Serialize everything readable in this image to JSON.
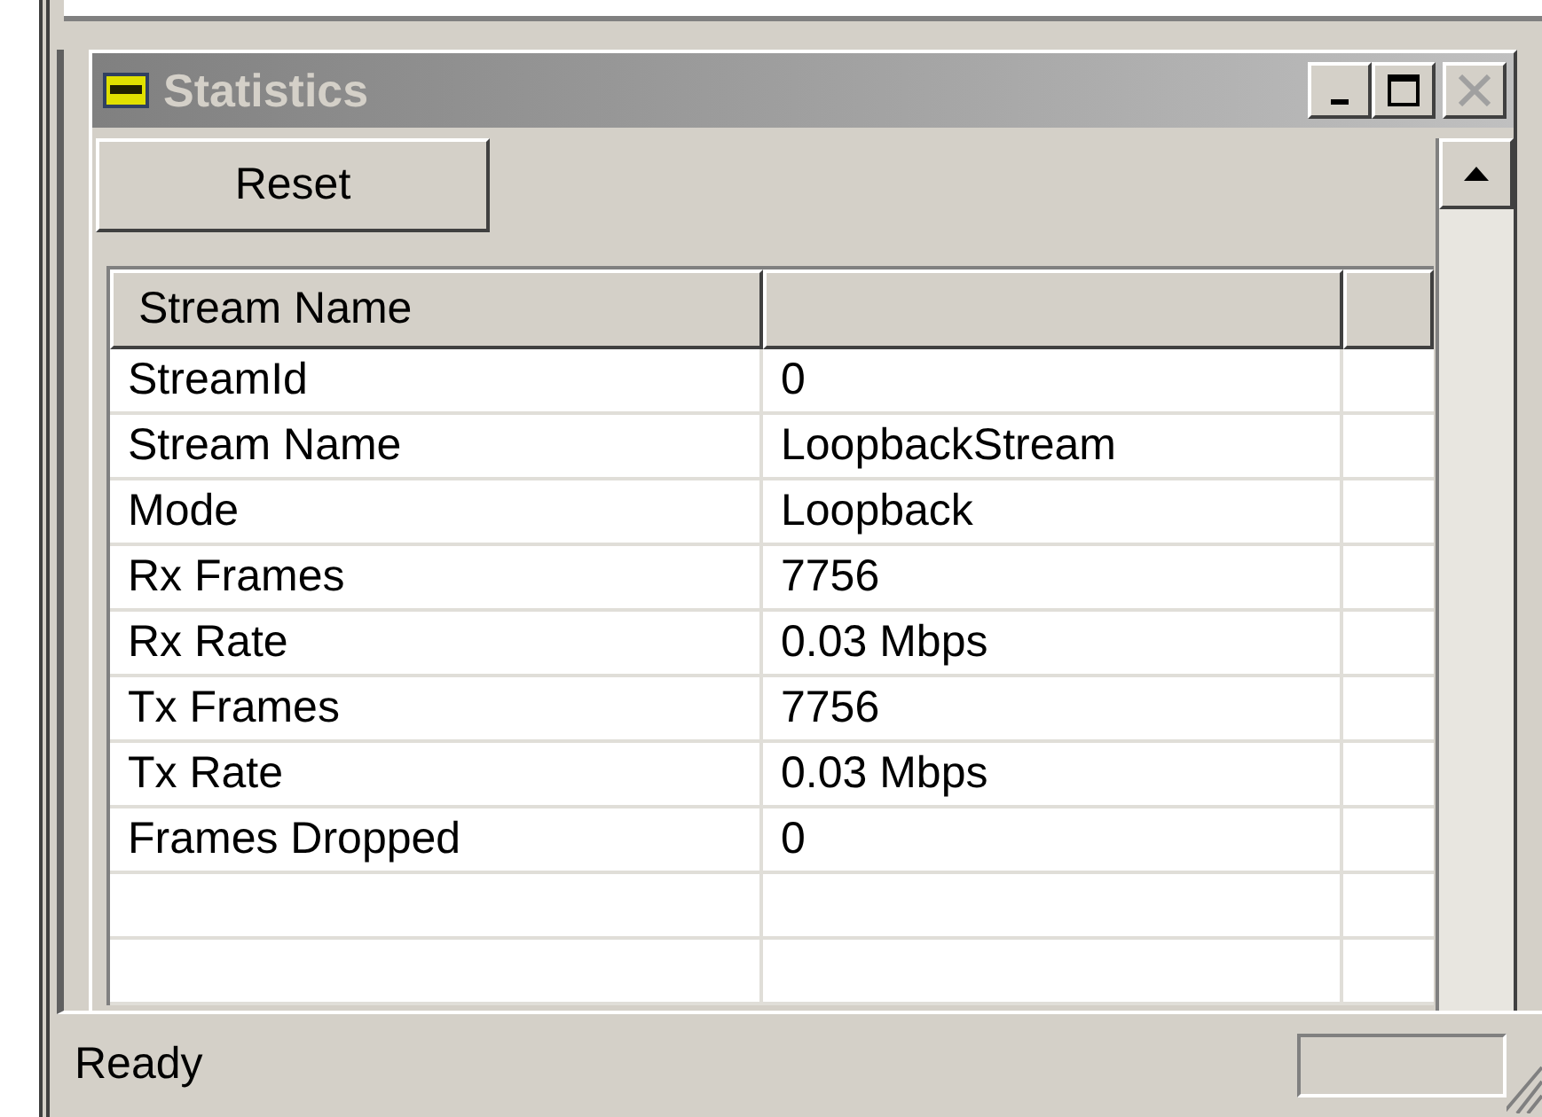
{
  "window": {
    "title": "Statistics",
    "active": false,
    "title_buttons": [
      {
        "kind": "minimize",
        "disabled": false
      },
      {
        "kind": "maximize",
        "disabled": false
      },
      {
        "kind": "close",
        "disabled": true
      }
    ]
  },
  "toolbar": {
    "buttons": [
      "Reset"
    ]
  },
  "table": {
    "columns": [
      "Stream Name"
    ],
    "rows": [
      [
        "StreamId",
        "0"
      ],
      [
        "Stream Name",
        "LoopbackStream"
      ],
      [
        "Mode",
        "Loopback"
      ],
      [
        "Rx Frames",
        "7756"
      ],
      [
        "Rx Rate",
        "0.03 Mbps"
      ],
      [
        "Tx Frames",
        "7756"
      ],
      [
        "Tx Rate",
        "0.03 Mbps"
      ],
      [
        "Frames Dropped",
        "0"
      ]
    ]
  },
  "status_bar": {
    "text": "Ready"
  }
}
